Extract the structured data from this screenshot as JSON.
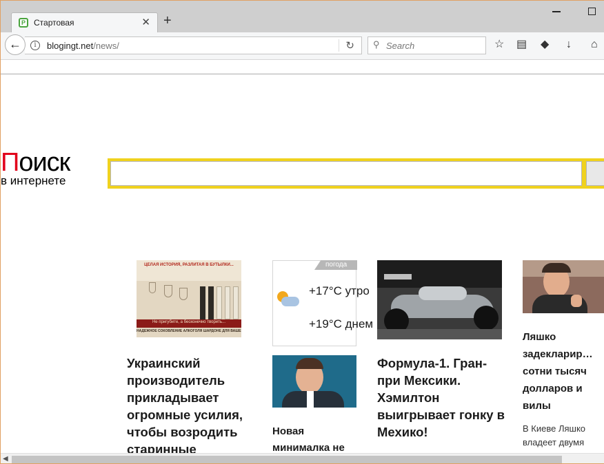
{
  "tab": {
    "title": "Стартовая",
    "favicon": "stylized-p-favicon-icon",
    "close_glyph": "✕"
  },
  "new_tab_glyph": "+",
  "navbar": {
    "back_glyph": "←",
    "info_glyph": "i",
    "url_host": "blogingt.net",
    "url_path": "/news/",
    "reload_glyph": "↻",
    "search_placeholder": "Search",
    "search_glyph": "⚲",
    "bookmark_glyph": "☆",
    "reader_glyph": "▤",
    "pocket_glyph": "◆",
    "download_glyph": "↓",
    "home_glyph": "⌂"
  },
  "logo": {
    "first_letter": "П",
    "rest": "оиск",
    "subtitle": "в интернете"
  },
  "weather": {
    "label": "погода",
    "morning": "+17°C утро",
    "day": "+19°C днем"
  },
  "ad_image": {
    "top_text": "ЦЕЛАЯ ИСТОРИЯ, РАЗЛИТАЯ В БУТЫЛКИ...",
    "mid_text": "Не пригубите, а бесконечно творить...",
    "bottom_text": "НАДЕЖНОЕ СОКОВЛЕНИЕ АЛКОГОЛЯ ШАРДОНЕ ДЛЯ ВАШЕГО ЗДОРОВЬЯ"
  },
  "news": [
    {
      "title": "Украинский производитель прикладывает огромные усилия, чтобы возродить старинные"
    },
    {
      "title": "Новая минималка не"
    },
    {
      "title": "Формула-1. Гран-при Мексики. Хэмилтон выигрывает гонку в Мехико!"
    },
    {
      "title": "Ляшко задекларир… сотни тысяч долларов и вилы",
      "snippet": "В Киеве Ляшко владеет двумя"
    }
  ],
  "colors": {
    "accent_yellow": "#f0d21e",
    "logo_red": "#e1001a",
    "tab_green": "#4aa43e"
  }
}
